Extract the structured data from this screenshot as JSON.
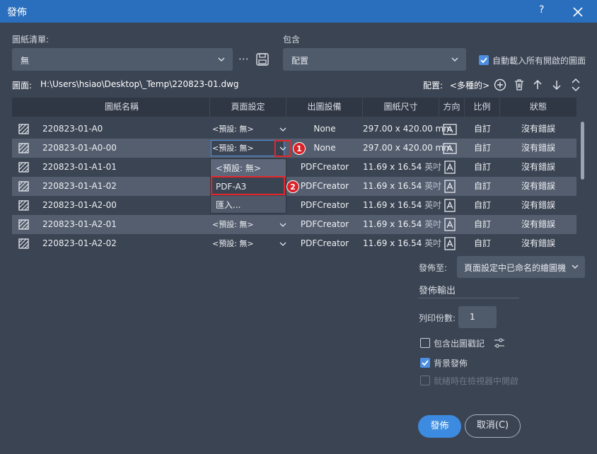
{
  "window": {
    "title": "發佈",
    "help": "?"
  },
  "sheet_list": {
    "label": "圖紙清單:",
    "value": "無",
    "more": "⋯"
  },
  "include": {
    "label": "包含",
    "value": "配置"
  },
  "auto_load": {
    "label": "自動載入所有開啟的圖面",
    "checked": true
  },
  "drawing": {
    "label": "圖面:",
    "path": "H:\\Users\\hsiao\\Desktop\\_Temp\\220823-01.dwg"
  },
  "layout": {
    "label": "配置:",
    "value": "<多種的>"
  },
  "table": {
    "headers": [
      "圖紙名稱",
      "頁面設定",
      "出圖設備",
      "圖紙尺寸",
      "方向",
      "比例",
      "狀態"
    ],
    "rows": [
      {
        "name": "220823-01-A0",
        "setup": "<預設: 無>",
        "device": "None",
        "size": "297.00 x 420.00 mm",
        "unit": "",
        "scale": "自訂",
        "status": "沒有錯誤"
      },
      {
        "name": "220823-01-A0-00",
        "setup": "<預設: 無>",
        "device": "None",
        "size": "297.00 x 420.00 mm",
        "unit": "",
        "scale": "自訂",
        "status": "沒有錯誤"
      },
      {
        "name": "220823-01-A1-01",
        "setup": "",
        "device": "PDFCreator",
        "size": "11.69 x 16.54",
        "unit": "英吋",
        "scale": "自訂",
        "status": "沒有錯誤"
      },
      {
        "name": "220823-01-A1-02",
        "setup": "",
        "device": "PDFCreator",
        "size": "11.69 x 16.54",
        "unit": "英吋",
        "scale": "自訂",
        "status": "沒有錯誤"
      },
      {
        "name": "220823-01-A2-00",
        "setup": "",
        "device": "PDFCreator",
        "size": "11.69 x 16.54",
        "unit": "英吋",
        "scale": "自訂",
        "status": "沒有錯誤"
      },
      {
        "name": "220823-01-A2-01",
        "setup": "<預設: 無>",
        "device": "PDFCreator",
        "size": "11.69 x 16.54",
        "unit": "英吋",
        "scale": "自訂",
        "status": "沒有錯誤"
      },
      {
        "name": "220823-01-A2-02",
        "setup": "<預設: 無>",
        "device": "PDFCreator",
        "size": "11.69 x 16.54",
        "unit": "英吋",
        "scale": "自訂",
        "status": "沒有錯誤"
      }
    ]
  },
  "setup_dropdown": {
    "options": [
      "<預設: 無>",
      "PDF-A3",
      "匯入..."
    ]
  },
  "annotations": {
    "badge1": "1",
    "badge2": "2"
  },
  "publish_to": {
    "label": "發佈至:",
    "value": "頁面設定中已命名的繪圖機"
  },
  "publish_output": {
    "label": "發佈輸出"
  },
  "copies": {
    "label": "列印份數:",
    "value": "1"
  },
  "include_stamp": {
    "label": "包含出圖戳記",
    "checked": false
  },
  "background_publish": {
    "label": "背景發佈",
    "checked": true
  },
  "open_viewer": {
    "label": "就緒時在檢視器中開啟",
    "checked": false,
    "disabled": true
  },
  "buttons": {
    "publish": "發佈",
    "cancel": "取消(C)"
  },
  "colors": {
    "titlebar": "#2a6fbd",
    "accent": "#3c8be0",
    "highlight": "#e4262a",
    "background": "#3b4453"
  }
}
